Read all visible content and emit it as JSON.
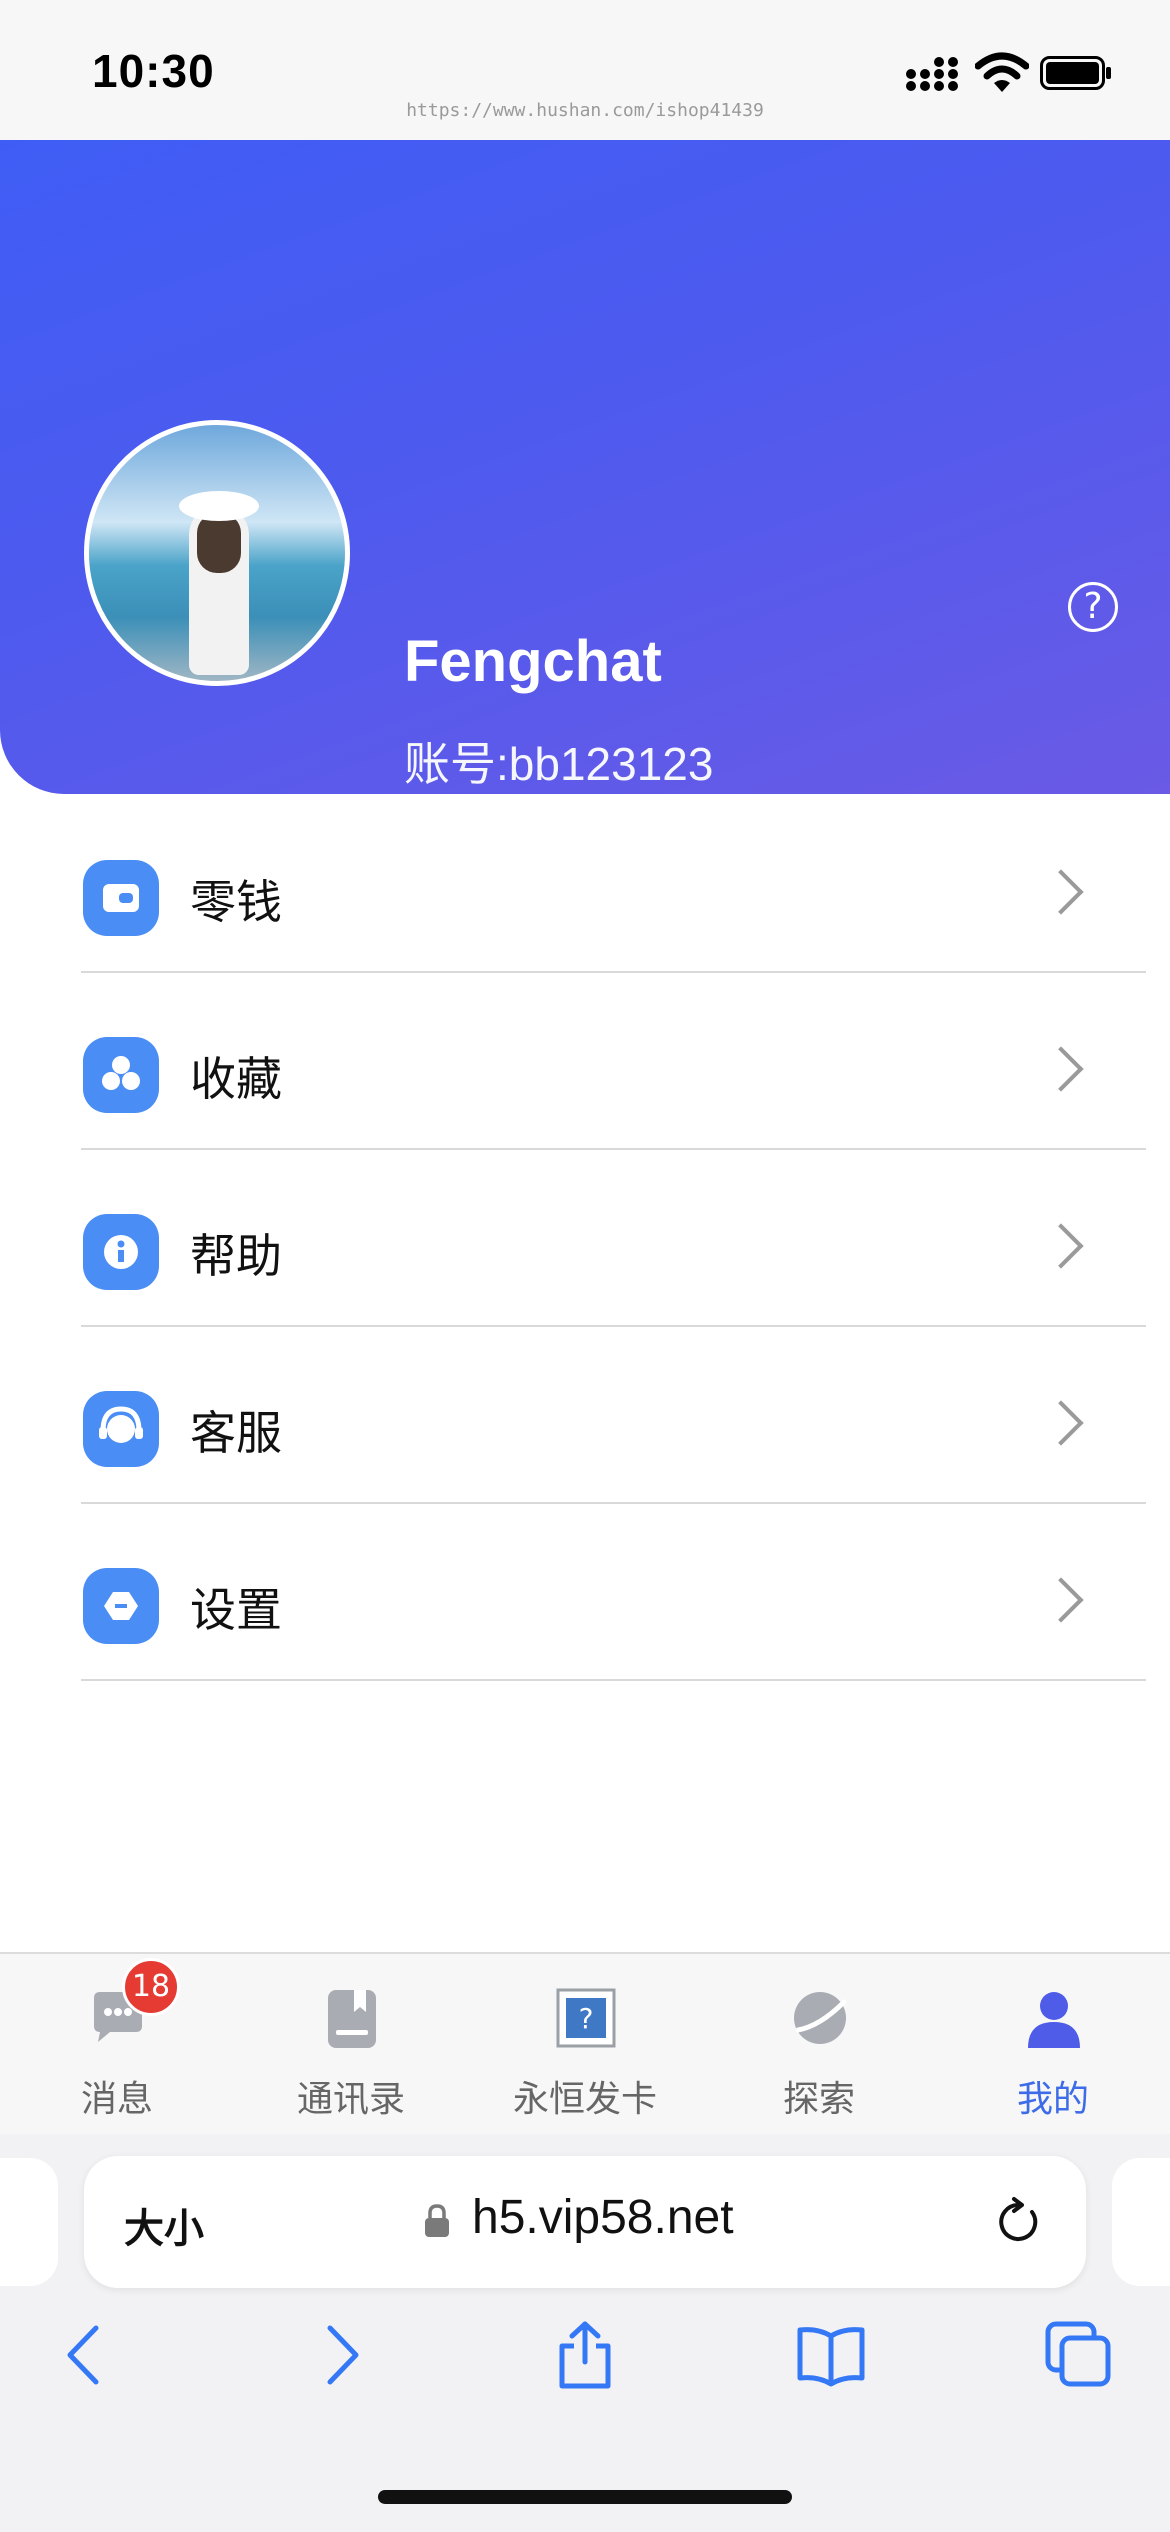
{
  "status_bar": {
    "time": "10:30",
    "watermark": "https://www.hushan.com/ishop41439"
  },
  "profile": {
    "name": "Fengchat",
    "account": "账号:bb123123",
    "help_icon": "question-circle-icon"
  },
  "menu": {
    "items": [
      {
        "label": "零钱",
        "icon": "wallet-icon"
      },
      {
        "label": "收藏",
        "icon": "favorites-icon"
      },
      {
        "label": "帮助",
        "icon": "info-icon"
      },
      {
        "label": "客服",
        "icon": "headset-icon"
      },
      {
        "label": "设置",
        "icon": "settings-icon"
      }
    ]
  },
  "tabbar": {
    "tabs": [
      {
        "label": "消息",
        "icon": "chat-icon",
        "badge": "18",
        "active": false
      },
      {
        "label": "通讯录",
        "icon": "contacts-icon",
        "active": false
      },
      {
        "label": "永恒发卡",
        "icon": "broken-image-icon",
        "active": false
      },
      {
        "label": "探索",
        "icon": "planet-icon",
        "active": false
      },
      {
        "label": "我的",
        "icon": "user-icon",
        "active": true
      }
    ],
    "active_color": "#3e6ce8"
  },
  "browser": {
    "text_size_label": "大小",
    "url": "h5.vip58.net"
  },
  "colors": {
    "header_gradient_start": "#3f5df5",
    "header_gradient_end": "#6a5ae6",
    "menu_icon_bg": "#4a8df5",
    "badge": "#e63b33"
  }
}
